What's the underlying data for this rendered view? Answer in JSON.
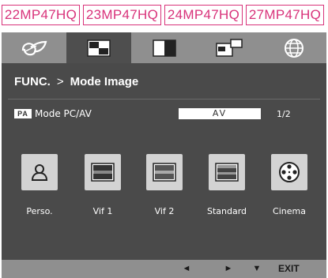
{
  "models": [
    "22MP47HQ",
    "23MP47HQ",
    "24MP47HQ",
    "27MP47HQ"
  ],
  "tabs": [
    {
      "icon": "eco-icon",
      "active": false
    },
    {
      "icon": "picture-mode-icon",
      "active": true
    },
    {
      "icon": "split-screen-icon",
      "active": false
    },
    {
      "icon": "pip-icon",
      "active": false
    },
    {
      "icon": "globe-icon",
      "active": false
    }
  ],
  "header": {
    "section": "FUNC.",
    "separator": ">",
    "page": "Mode Image"
  },
  "mode": {
    "badge": "PA",
    "label": "Mode PC/AV",
    "value": "AV",
    "page": "1/2"
  },
  "options": [
    {
      "label": "Perso.",
      "icon": "person-icon"
    },
    {
      "label": "Vif 1",
      "icon": "vivid-1-icon"
    },
    {
      "label": "Vif 2",
      "icon": "vivid-2-icon"
    },
    {
      "label": "Standard",
      "icon": "standard-icon"
    },
    {
      "label": "Cinema",
      "icon": "film-reel-icon"
    }
  ],
  "bottom": {
    "left": "◄",
    "right": "►",
    "down": "▼",
    "exit": "EXIT"
  }
}
